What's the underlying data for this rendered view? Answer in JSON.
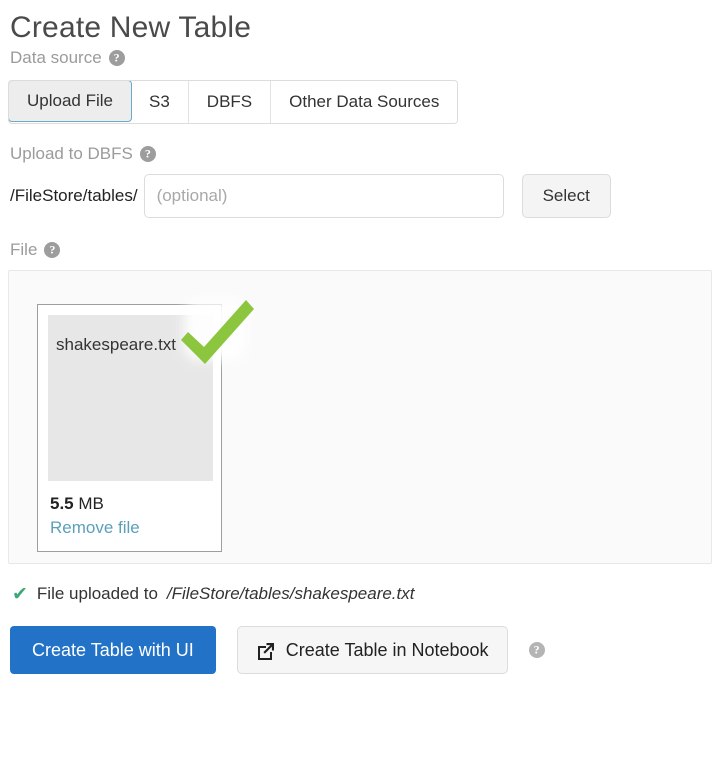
{
  "page": {
    "title": "Create New Table"
  },
  "data_source": {
    "label": "Data source",
    "help_icon": "help-circle-icon",
    "tabs": [
      {
        "label": "Upload File",
        "active": true
      },
      {
        "label": "S3",
        "active": false
      },
      {
        "label": "DBFS",
        "active": false
      },
      {
        "label": "Other Data Sources",
        "active": false
      }
    ]
  },
  "upload_to_dbfs": {
    "label": "Upload to DBFS",
    "help_icon": "help-circle-icon",
    "path_prefix": "/FileStore/tables/",
    "path_value": "",
    "path_placeholder": "(optional)",
    "select_label": "Select"
  },
  "file_section": {
    "label": "File",
    "help_icon": "help-circle-icon",
    "file_card": {
      "name": "shakespeare.txt",
      "size_value": "5.5",
      "size_unit": "MB",
      "remove_label": "Remove file",
      "status_icon": "green-check-icon"
    }
  },
  "upload_status": {
    "icon": "check-icon",
    "text": "File uploaded to",
    "path": "/FileStore/tables/shakespeare.txt"
  },
  "actions": {
    "primary_label": "Create Table with UI",
    "secondary_label": "Create Table in Notebook",
    "secondary_icon": "external-link-icon",
    "help_icon": "help-circle-icon"
  },
  "colors": {
    "primary_button": "#2272c8",
    "active_tab_border": "#6aabc4",
    "link": "#5c9fba",
    "success_check": "#3ea977",
    "file_check": "#8cc63f",
    "label_gray": "#9b9b9b"
  }
}
